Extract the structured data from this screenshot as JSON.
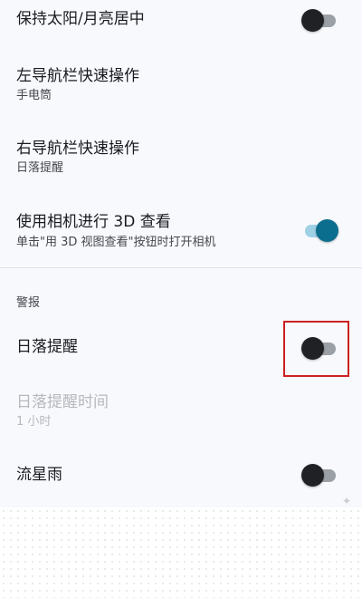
{
  "settings": {
    "keep_centered": {
      "title": "保持太阳/月亮居中",
      "enabled": false
    },
    "left_nav_action": {
      "title": "左导航栏快速操作",
      "value": "手电筒"
    },
    "right_nav_action": {
      "title": "右导航栏快速操作",
      "value": "日落提醒"
    },
    "camera_3d": {
      "title": "使用相机进行 3D 查看",
      "summary": "单击\"用 3D 视图查看\"按钮时打开相机",
      "enabled": true
    }
  },
  "alerts": {
    "header": "警报",
    "sunset_alert": {
      "title": "日落提醒",
      "enabled": false
    },
    "sunset_alert_time": {
      "title": "日落提醒时间",
      "value": "1 小时",
      "disabled": true
    },
    "meteor_shower": {
      "title": "流星雨",
      "enabled": false
    }
  },
  "colors": {
    "switch_on": "#0b6e8f",
    "switch_off": "#202124",
    "highlight": "#cc2020"
  }
}
